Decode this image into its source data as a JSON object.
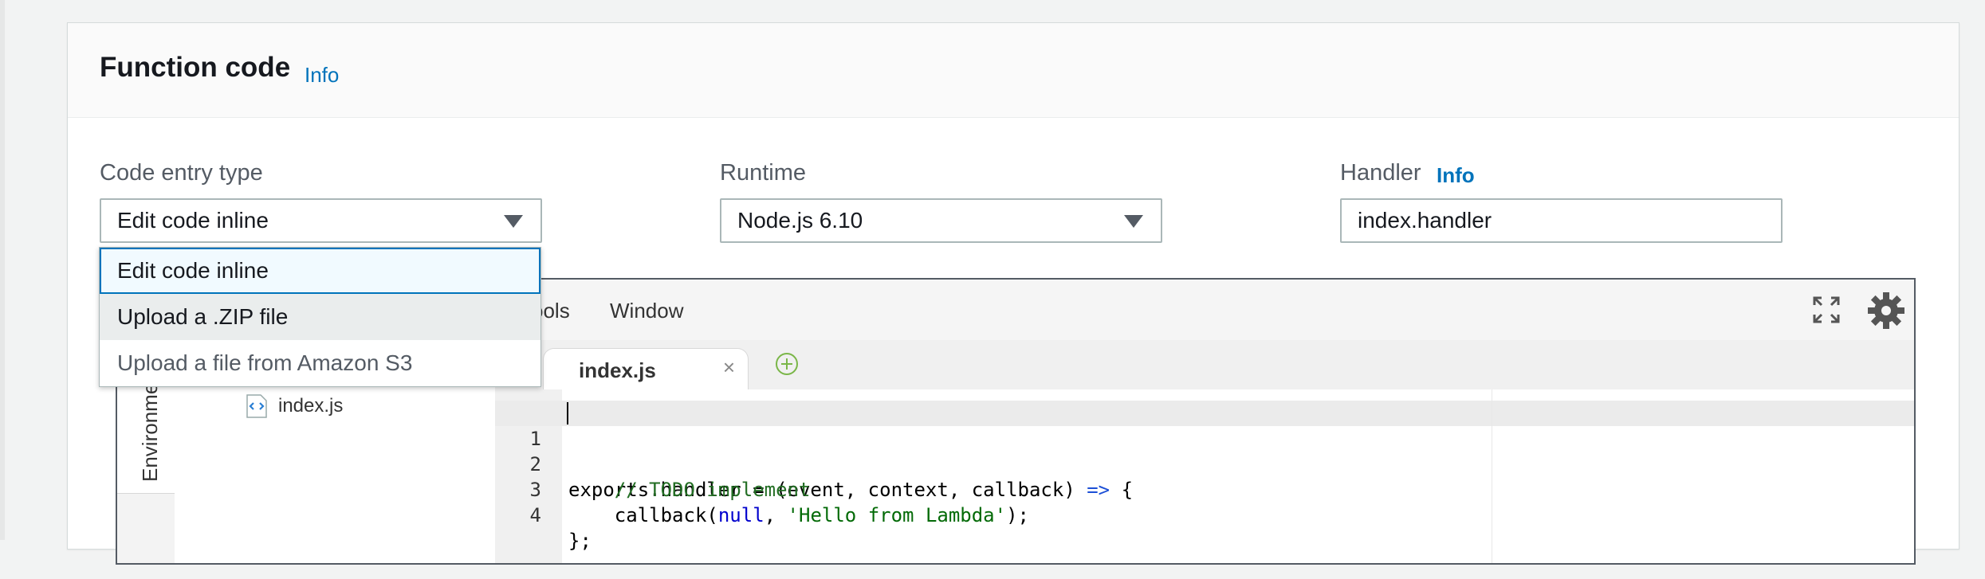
{
  "panel": {
    "title": "Function code",
    "info_label": "Info"
  },
  "code_entry": {
    "label": "Code entry type",
    "value": "Edit code inline",
    "options": [
      "Edit code inline",
      "Upload a .ZIP file",
      "Upload a file from Amazon S3"
    ]
  },
  "runtime": {
    "label": "Runtime",
    "value": "Node.js 6.10"
  },
  "handler": {
    "label": "Handler",
    "info_label": "Info",
    "value": "index.handler"
  },
  "editor": {
    "menu": [
      "Tools",
      "Window"
    ],
    "menu_visible_fragment": "ools",
    "sidebar_tab": "Environment",
    "tree_file": "index.js",
    "open_tab": "index.js",
    "code_lines": [
      {
        "n": "1",
        "text": "exports.handler = (event, context, callback) => {"
      },
      {
        "n": "2",
        "text": "    // TODO implement"
      },
      {
        "n": "3",
        "text": "    callback(null, 'Hello from Lambda');"
      },
      {
        "n": "4",
        "text": "};"
      }
    ]
  },
  "colors": {
    "accent": "#0073bb",
    "hover_row": "#eaeded",
    "selected_row_bg": "#f1faff"
  },
  "icons": [
    "fullscreen-icon",
    "gear-icon",
    "close-icon",
    "add-tab-icon",
    "js-file-icon",
    "caret-down-icon"
  ]
}
